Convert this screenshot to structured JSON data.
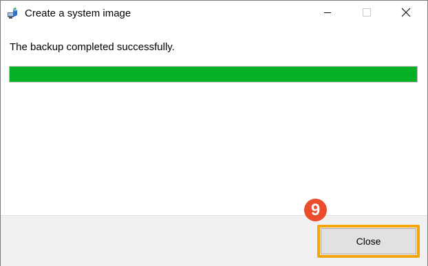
{
  "window": {
    "title": "Create a system image",
    "app_icon": "system-image-backup-icon",
    "controls": {
      "minimize_icon": "minimize-icon",
      "maximize_icon": "maximize-icon",
      "close_icon": "close-icon"
    }
  },
  "content": {
    "message": "The backup completed successfully.",
    "progress": {
      "value_percent": 100,
      "fill_color": "#06b025"
    }
  },
  "footer": {
    "close_label": "Close"
  },
  "annotation": {
    "step_number": "9",
    "badge_color": "#ea4c2c",
    "highlight_color": "#f5a40b"
  }
}
